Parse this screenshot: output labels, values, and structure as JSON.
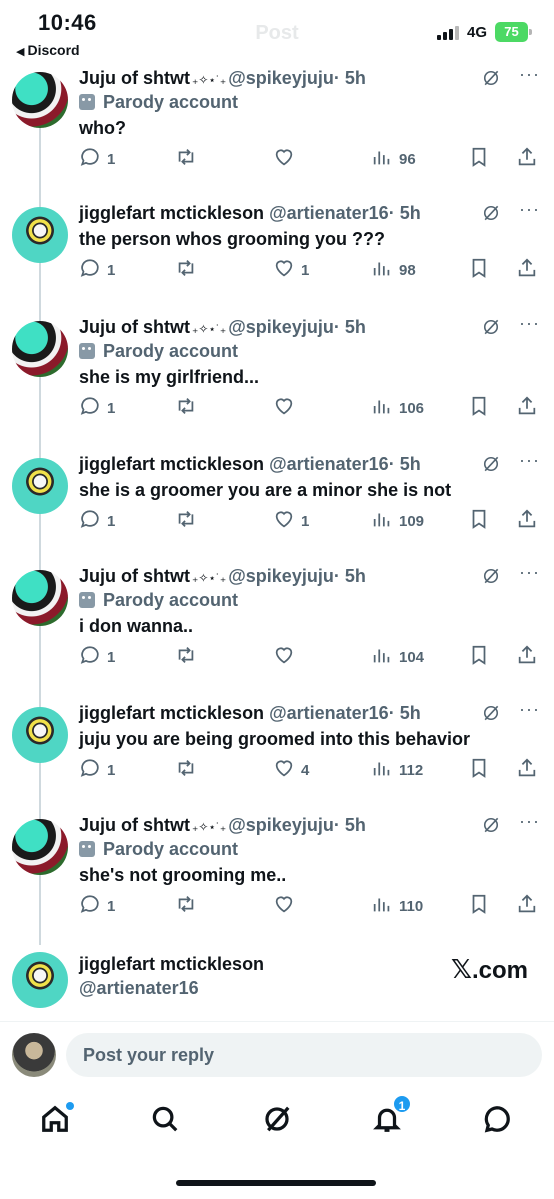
{
  "status_bar": {
    "time": "10:46",
    "back_app": "Discord",
    "network": "4G",
    "battery": "75"
  },
  "header": {
    "title": "Post"
  },
  "tweets": [
    {
      "name": "Juju of shtwt",
      "badge": "₊✧⋆˙₊",
      "handle": "@spikeyjuju",
      "time": "· 5h",
      "parody": "Parody account",
      "text": "who?",
      "replies": "1",
      "retweets": "",
      "likes": "",
      "views": "96"
    },
    {
      "name": "jigglefart mctickleson",
      "handle": "@artienater16",
      "time": "· 5h",
      "text": "the person whos grooming you ???",
      "replies": "1",
      "retweets": "",
      "likes": "1",
      "views": "98"
    },
    {
      "name": "Juju of shtwt",
      "badge": "₊✧⋆˙₊",
      "handle": "@spikeyjuju",
      "time": "· 5h",
      "parody": "Parody account",
      "text": "she is my girlfriend...",
      "replies": "1",
      "retweets": "",
      "likes": "",
      "views": "106"
    },
    {
      "name": "jigglefart mctickleson",
      "handle": "@artienater16",
      "time": "· 5h",
      "text": "she is a groomer you are a minor she is not",
      "replies": "1",
      "retweets": "",
      "likes": "1",
      "views": "109"
    },
    {
      "name": "Juju of shtwt",
      "badge": "₊✧⋆˙₊",
      "handle": "@spikeyjuju",
      "time": "· 5h",
      "parody": "Parody account",
      "text": "i don wanna..",
      "replies": "1",
      "retweets": "",
      "likes": "",
      "views": "104"
    },
    {
      "name": "jigglefart mctickleson",
      "handle": "@artienater16",
      "time": "· 5h",
      "text": "juju you are being groomed into this behavior",
      "replies": "1",
      "retweets": "",
      "likes": "4",
      "views": "112"
    },
    {
      "name": "Juju of shtwt",
      "badge": "₊✧⋆˙₊",
      "handle": "@spikeyjuju",
      "time": "· 5h",
      "parody": "Parody account",
      "text": "she's not grooming me..",
      "replies": "1",
      "retweets": "",
      "likes": "",
      "views": "110"
    }
  ],
  "author_card": {
    "name": "jigglefart mctickleson",
    "handle": "@artienater16",
    "watermark_x": "𝕏",
    "watermark_com": ".com"
  },
  "reply_bar": {
    "placeholder": "Post your reply"
  },
  "tabbar": {
    "notifications_count": "1"
  },
  "colors": {
    "accent": "#1d9bf0",
    "muted": "#536471",
    "text": "#0f1419",
    "battery": "#4cd964"
  }
}
